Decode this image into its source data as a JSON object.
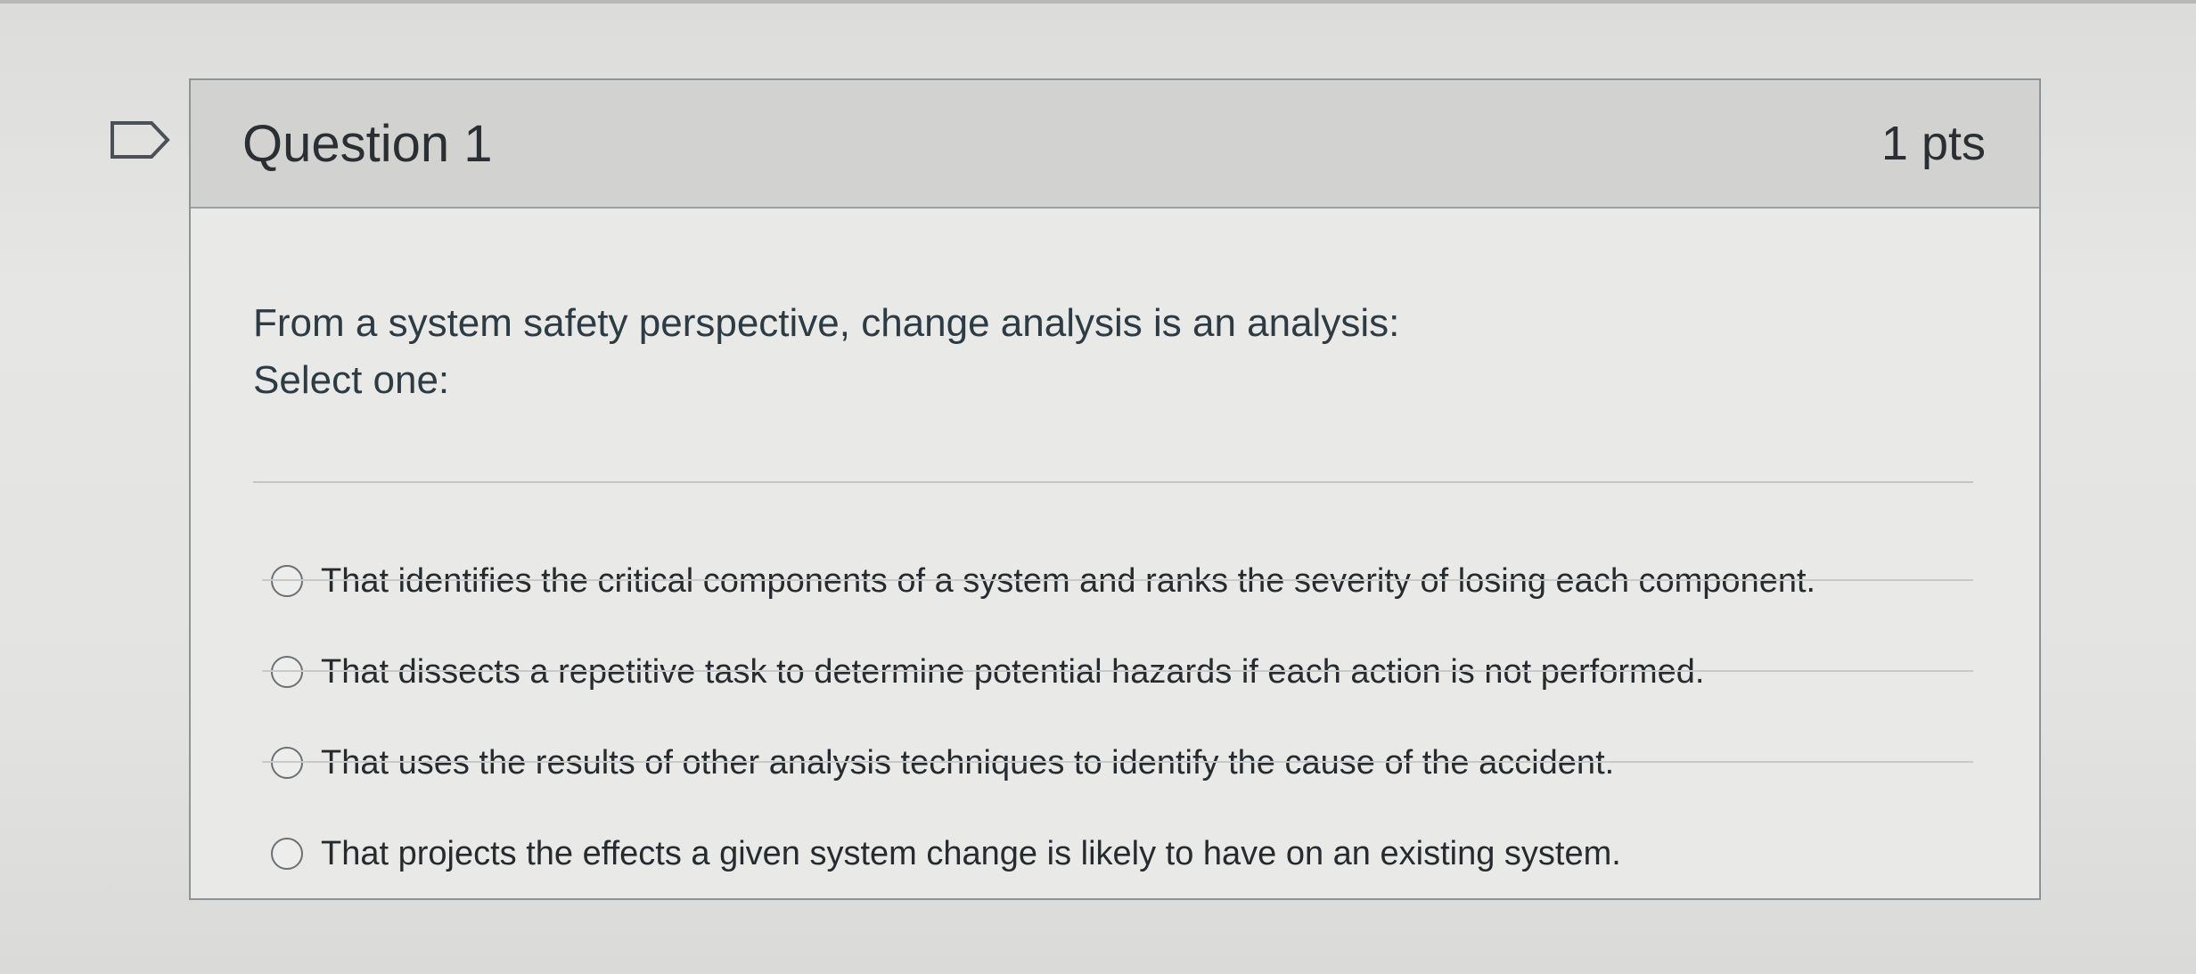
{
  "question": {
    "title": "Question 1",
    "points": "1 pts",
    "text": "From a system safety perspective, change analysis is an analysis:",
    "prompt": "Select one:",
    "answers": [
      {
        "label": "That identifies the critical components of a system and ranks the severity of losing each component."
      },
      {
        "label": "That dissects a repetitive task to determine potential hazards if each action is not performed."
      },
      {
        "label": "That uses the results of other analysis techniques to identify the cause of the accident."
      },
      {
        "label": "That projects the effects a given system change is likely to have on an existing system."
      }
    ]
  },
  "icons": {
    "flag": "flag-outline-icon"
  },
  "colors": {
    "header_bg": "#d2d3d1",
    "card_bg": "#e9e9e7",
    "text": "#2d3b45"
  }
}
